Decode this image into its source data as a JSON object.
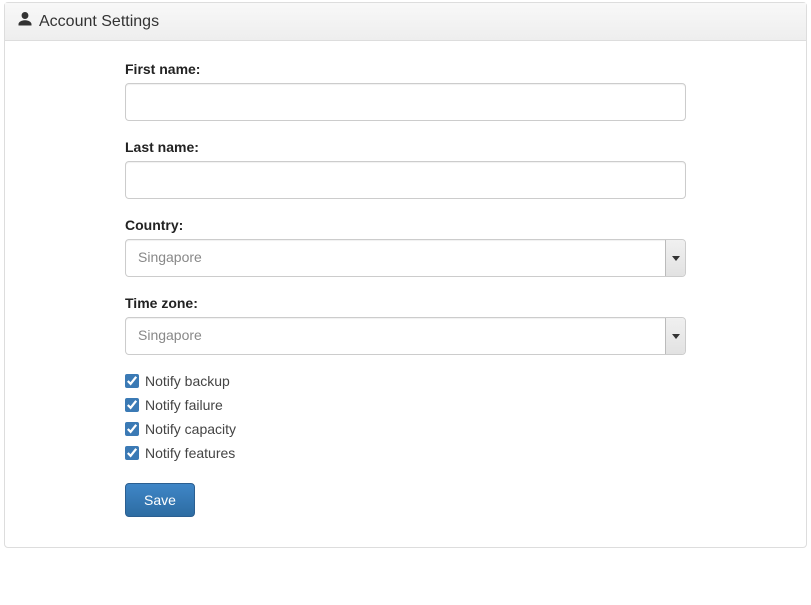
{
  "header": {
    "title": "Account Settings"
  },
  "form": {
    "first_name": {
      "label": "First name:",
      "value": ""
    },
    "last_name": {
      "label": "Last name:",
      "value": ""
    },
    "country": {
      "label": "Country:",
      "selected": "Singapore"
    },
    "timezone": {
      "label": "Time zone:",
      "selected": "Singapore"
    },
    "checkboxes": [
      {
        "label": "Notify backup",
        "checked": true
      },
      {
        "label": "Notify failure",
        "checked": true
      },
      {
        "label": "Notify capacity",
        "checked": true
      },
      {
        "label": "Notify features",
        "checked": true
      }
    ],
    "save_label": "Save"
  }
}
